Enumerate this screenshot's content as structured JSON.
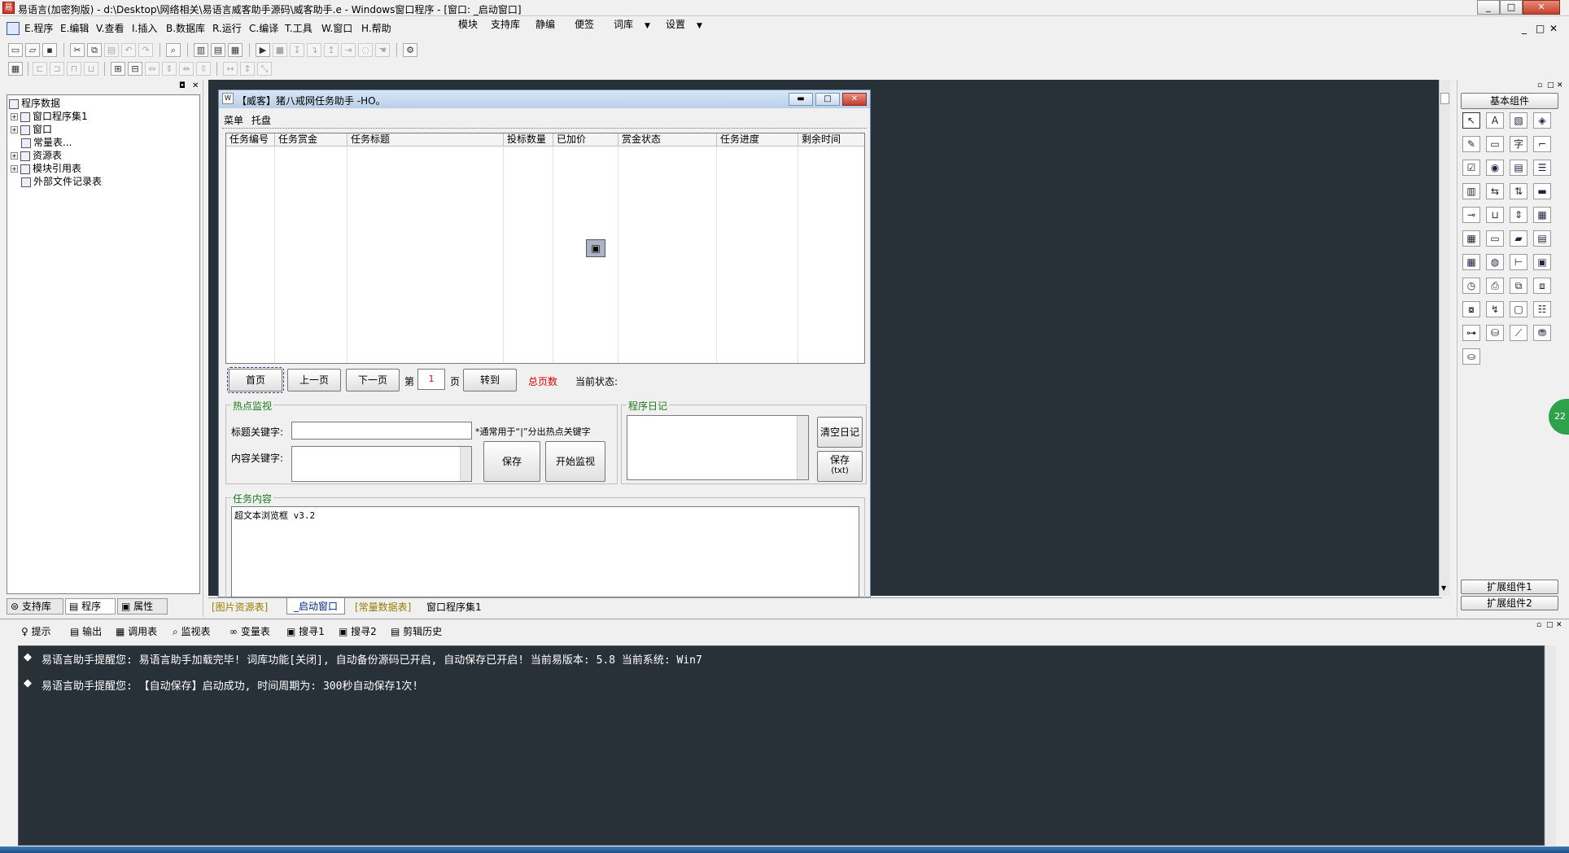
{
  "title_bar": {
    "title": "易语言(加密狗版) - d:\\Desktop\\网络相关\\易语言威客助手源码\\威客助手.e - Windows窗口程序 - [窗口: _启动窗口]",
    "min": "_",
    "restore": "□",
    "close": "✕"
  },
  "menu": {
    "items": [
      "E.程序",
      "E.编辑",
      "V.查看",
      "I.插入",
      "B.数据库",
      "R.运行",
      "C.编译",
      "T.工具",
      "W.窗口",
      "H.帮助"
    ],
    "extra": [
      "模块",
      "支持库",
      "静编",
      "便签",
      "词库",
      "设置"
    ],
    "mdi_min": "_",
    "mdi_restore": "□",
    "mdi_close": "✕"
  },
  "left_panel": {
    "tree": [
      {
        "label": "程序数据",
        "icon": "root-icon",
        "expander": ""
      },
      {
        "label": "窗口程序集1",
        "icon": "code-icon",
        "expander": "+"
      },
      {
        "label": "窗口",
        "icon": "window-icon",
        "expander": "+"
      },
      {
        "label": "常量表...",
        "icon": "table-icon",
        "expander": ""
      },
      {
        "label": "资源表",
        "icon": "resource-icon",
        "expander": "+"
      },
      {
        "label": "模块引用表",
        "icon": "module-icon",
        "expander": "+"
      },
      {
        "label": "外部文件记录表",
        "icon": "file-icon",
        "expander": ""
      }
    ],
    "tabs": [
      "支持库",
      "程序",
      "属性"
    ]
  },
  "form": {
    "title": "【威客】猪八戒网任务助手 -HO。",
    "menu_items": [
      "菜单",
      "托盘"
    ],
    "grid_columns": [
      "任务编号",
      "任务赏金",
      "任务标题",
      "投标数量",
      "已加价",
      "赏金状态",
      "任务进度",
      "剩余时间"
    ],
    "pager": {
      "first": "首页",
      "prev": "上一页",
      "next": "下一页",
      "page_prefix": "第",
      "page_value": "1",
      "page_suffix": "页",
      "goto": "转到",
      "total_pages": "总页数",
      "status_label": "当前状态:"
    },
    "hot_monitor": {
      "group_label": "热点监视",
      "title_kw_label": "标题关键字:",
      "title_kw_value": "",
      "hint": "*通常用于“|”分出热点关键字",
      "content_kw_label": "内容关键字:",
      "save": "保存",
      "start": "开始监视"
    },
    "log": {
      "group_label": "程序日记",
      "clear": "清空日记",
      "save_line1": "保存",
      "save_line2": "(txt)"
    },
    "task_content": {
      "group_label": "任务内容",
      "text": "超文本浏览框 v3.2"
    }
  },
  "doc_tabs": [
    "[图片资源表]",
    "_启动窗口",
    "[常量数据表]",
    "窗口程序集1"
  ],
  "components": {
    "header": "基本组件",
    "footer1": "扩展组件1",
    "footer2": "扩展组件2"
  },
  "bottom_tabs": [
    "提示",
    "输出",
    "调用表",
    "监视表",
    "变量表",
    "搜寻1",
    "搜寻2",
    "剪辑历史"
  ],
  "messages": [
    "易语言助手提醒您:  易语言助手加载完毕! 词库功能[关闭], 自动备份源码已开启, 自动保存已开启!  当前易版本: 5.8  当前系统: Win7",
    "易语言助手提醒您: 【自动保存】启动成功, 时间周期为: 300秒自动保存1次!"
  ],
  "side_badge": "22",
  "colors": {
    "accent_green": "#1b7c1b",
    "red_label": "#e00000",
    "dark_area": "#283038"
  }
}
